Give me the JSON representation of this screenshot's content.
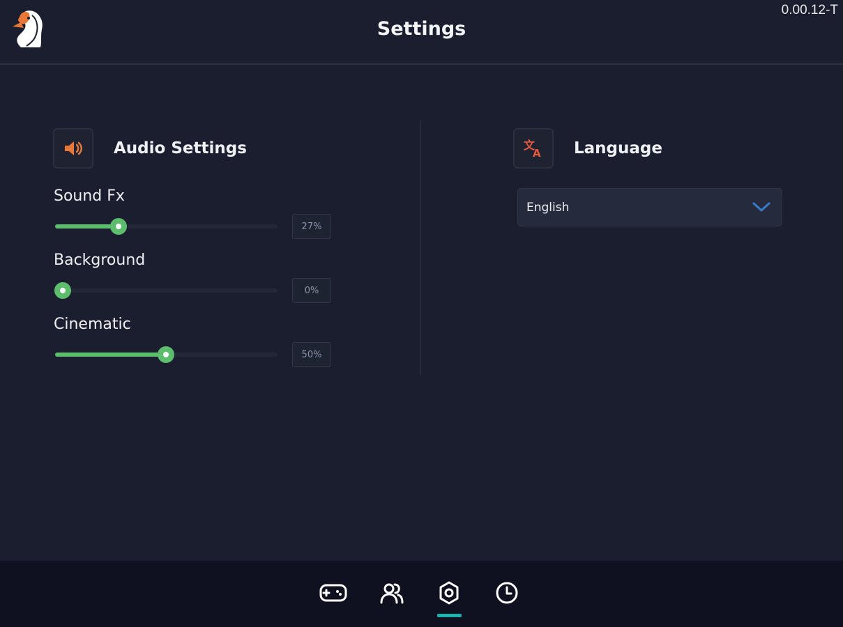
{
  "header": {
    "title": "Settings",
    "version": "0.00.12-T"
  },
  "audio": {
    "title": "Audio Settings",
    "icon": "speaker-icon",
    "sliders": [
      {
        "label": "Sound Fx",
        "value": 27,
        "display": "27%"
      },
      {
        "label": "Background",
        "value": 0,
        "display": "0%"
      },
      {
        "label": "Cinematic",
        "value": 50,
        "display": "50%"
      }
    ]
  },
  "language": {
    "title": "Language",
    "icon": "translate-icon",
    "selected": "English"
  },
  "nav": {
    "items": [
      {
        "icon": "gamepad-icon",
        "active": false
      },
      {
        "icon": "users-icon",
        "active": false
      },
      {
        "icon": "settings-icon",
        "active": true
      },
      {
        "icon": "clock-icon",
        "active": false
      }
    ]
  },
  "colors": {
    "background": "#1a1e2f",
    "accent_green": "#5cbd6d",
    "accent_orange": "#e8783a",
    "nav_indicator": "#19b3b0"
  }
}
